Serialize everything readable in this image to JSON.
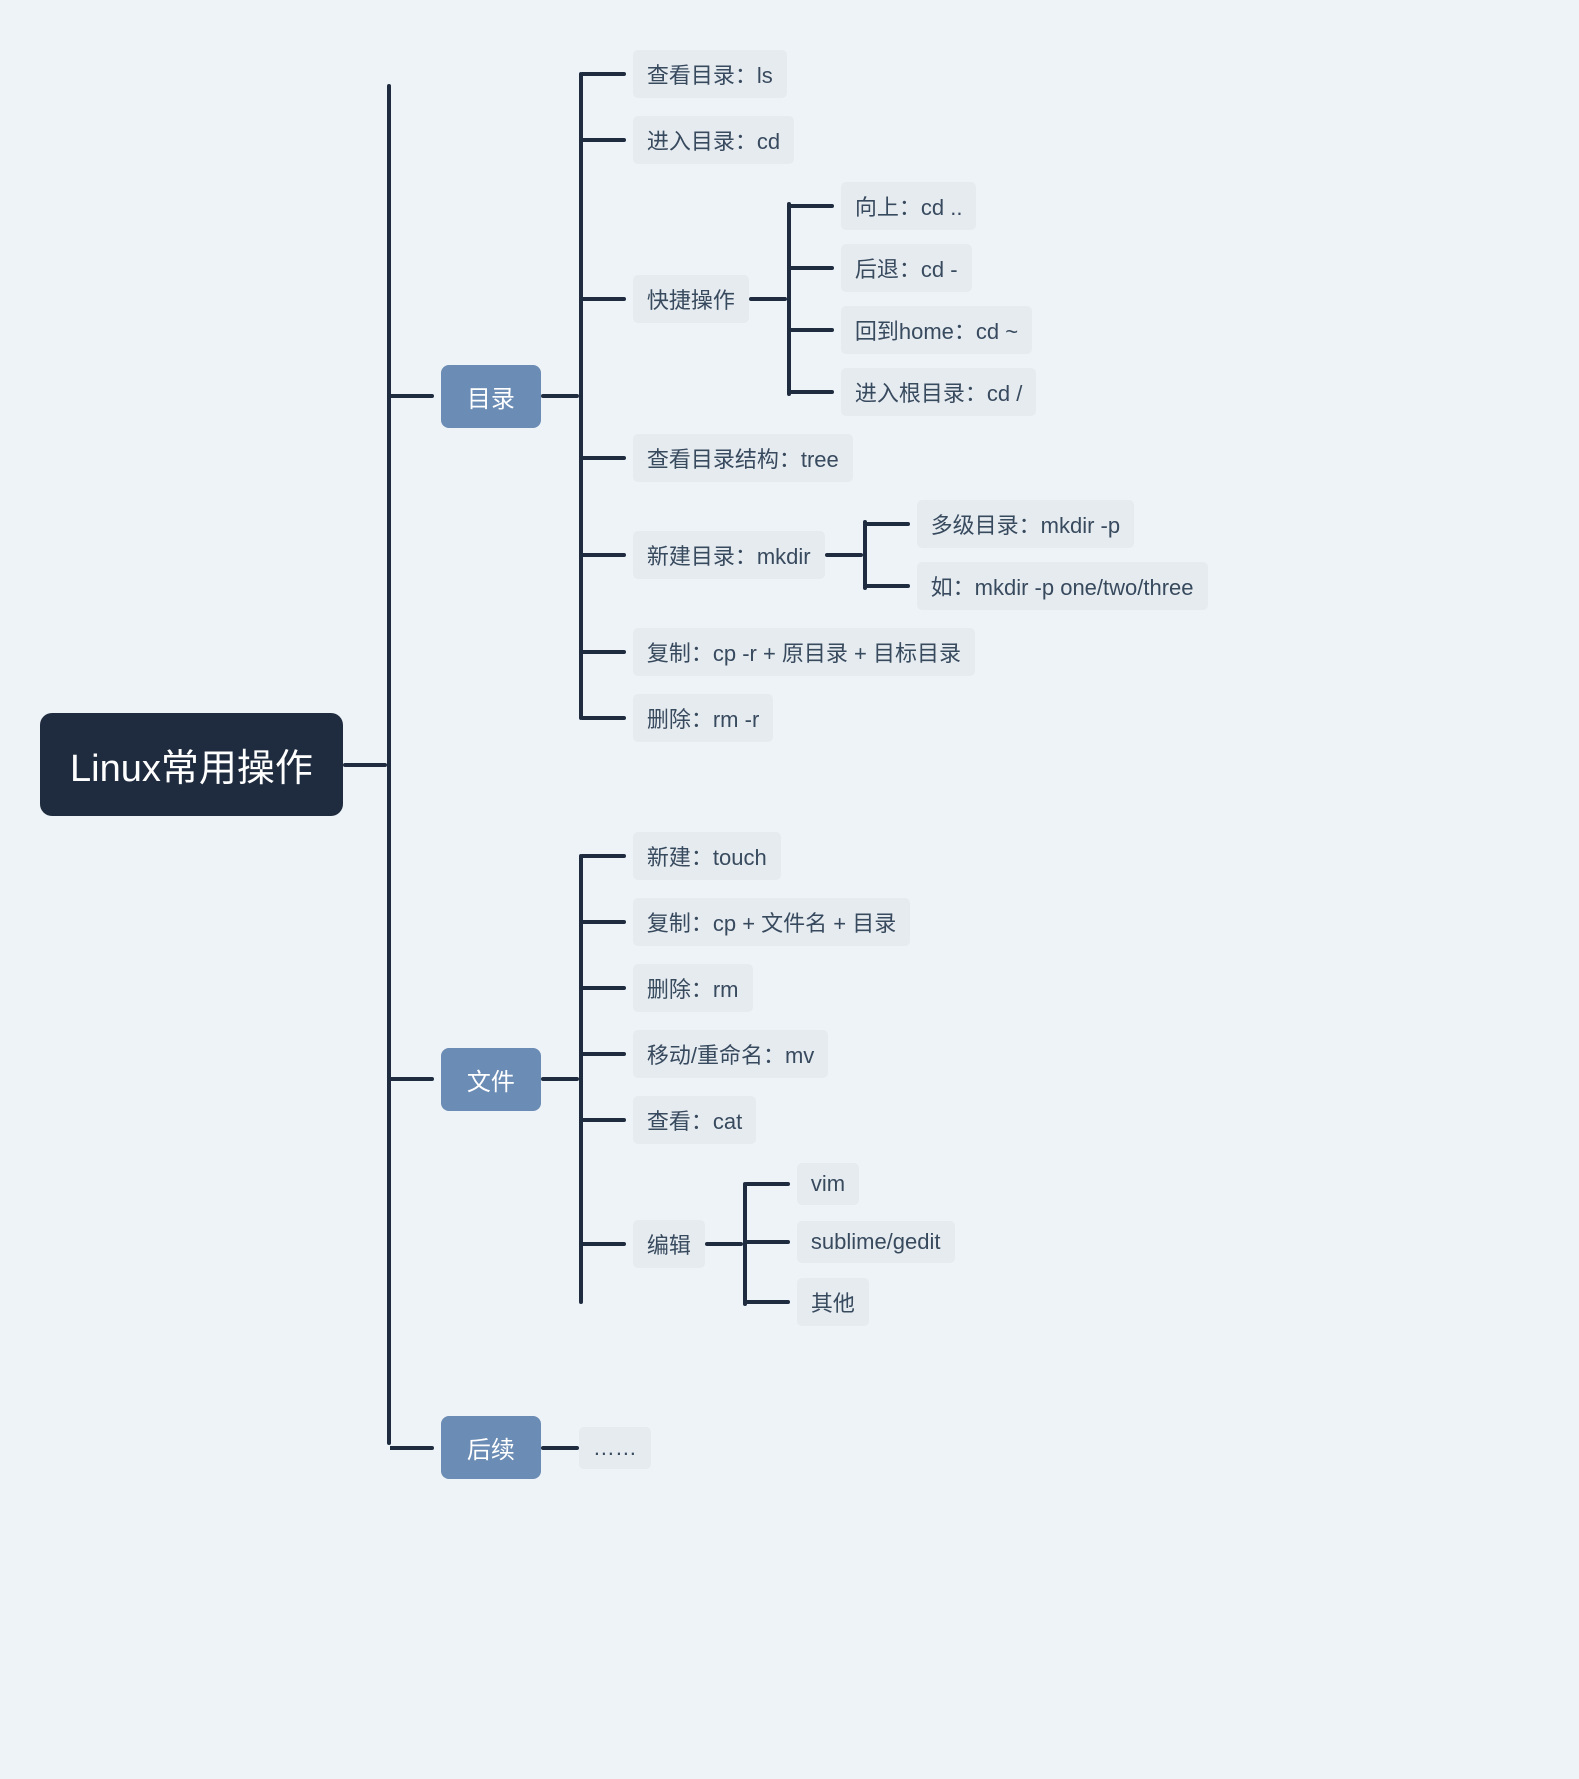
{
  "root": "Linux常用操作",
  "branches": {
    "dir": {
      "title": "目录",
      "ls": "查看目录：ls",
      "cd": "进入目录：cd",
      "shortcut": {
        "title": "快捷操作",
        "up": "向上：cd ..",
        "back": "后退：cd -",
        "home": "回到home：cd ~",
        "root": "进入根目录：cd /"
      },
      "tree": "查看目录结构：tree",
      "mkdir": {
        "title": "新建目录：mkdir",
        "p": "多级目录：mkdir -p",
        "eg": "如：mkdir -p one/two/three"
      },
      "cp": "复制：cp -r + 原目录 + 目标目录",
      "rm": "删除：rm -r"
    },
    "file": {
      "title": "文件",
      "touch": "新建：touch",
      "cp": "复制：cp + 文件名 + 目录",
      "rm": "删除：rm",
      "mv": "移动/重命名：mv",
      "cat": "查看：cat",
      "edit": {
        "title": "编辑",
        "vim": "vim",
        "sublime": "sublime/gedit",
        "other": "其他"
      }
    },
    "more": {
      "title": "后续",
      "etc": "……"
    }
  }
}
